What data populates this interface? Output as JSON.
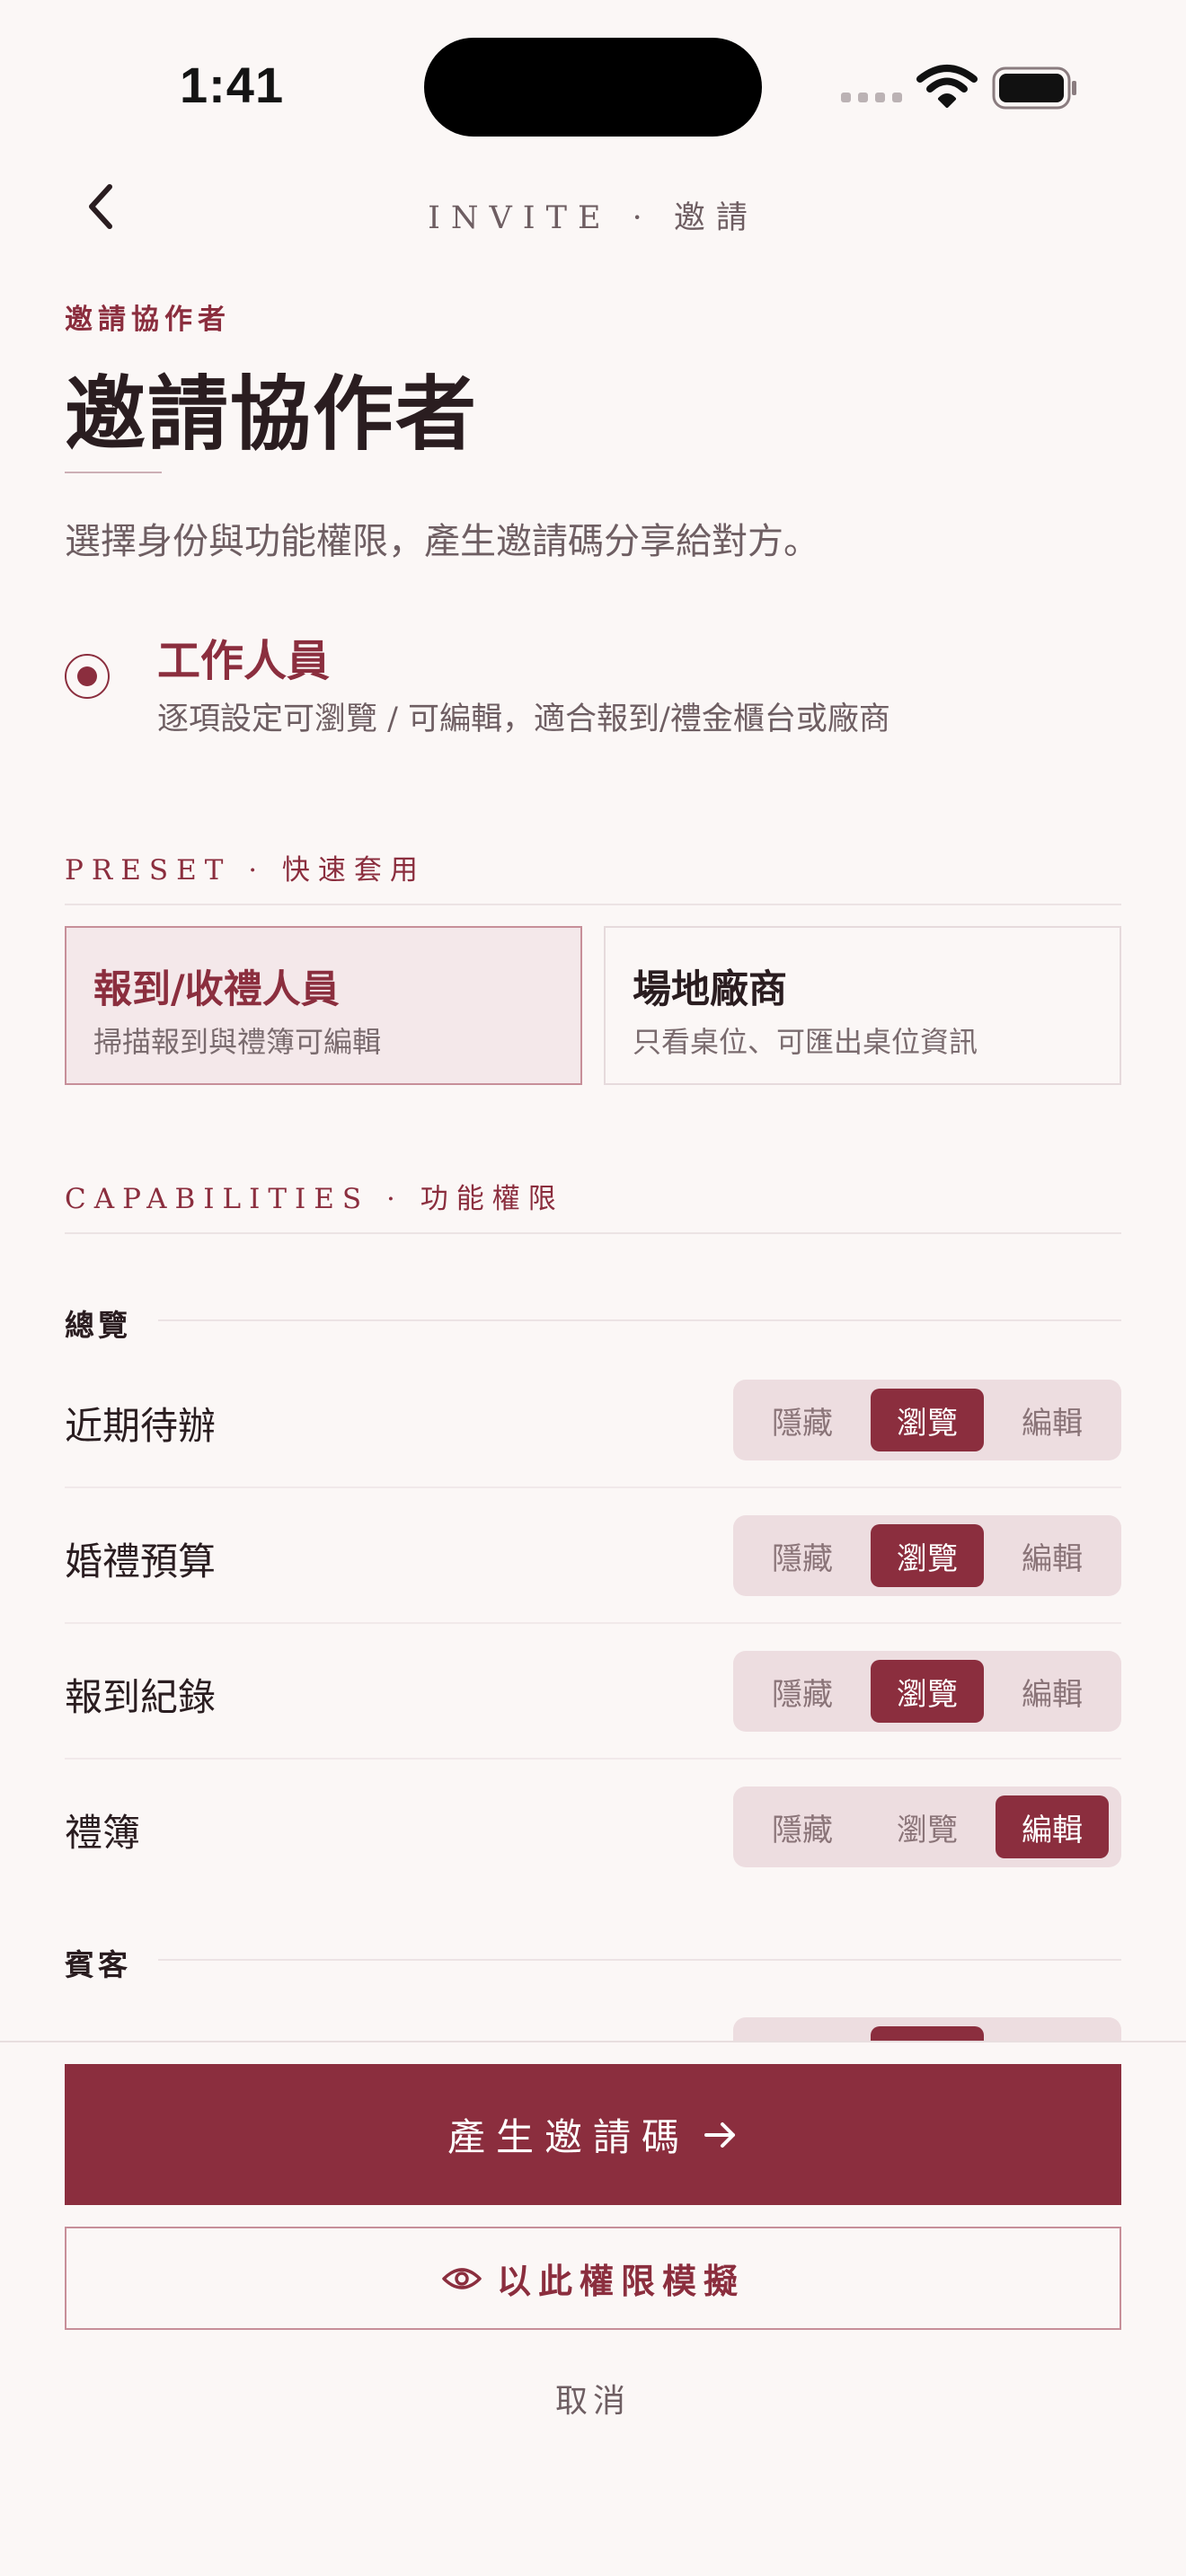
{
  "status_bar": {
    "time": "1:41"
  },
  "nav": {
    "title": "INVITE · 邀請"
  },
  "header": {
    "eyebrow": "邀請協作者",
    "title": "邀請協作者",
    "subtitle": "選擇身份與功能權限，產生邀請碼分享給對方。"
  },
  "role": {
    "selected": true,
    "title": "工作人員",
    "description": "逐項設定可瀏覽 / 可編輯，適合報到/禮金櫃台或廠商"
  },
  "preset": {
    "heading": "PRESET · 快速套用",
    "cards": [
      {
        "title": "報到/收禮人員",
        "description": "掃描報到與禮簿可編輯",
        "active": true
      },
      {
        "title": "場地廠商",
        "description": "只看桌位、可匯出桌位資訊",
        "active": false
      }
    ]
  },
  "capabilities": {
    "heading": "CAPABILITIES · 功能權限",
    "options": [
      "隱藏",
      "瀏覽",
      "編輯"
    ],
    "groups": [
      {
        "label": "總覽",
        "items": [
          {
            "label": "近期待辦",
            "selected": "瀏覽"
          },
          {
            "label": "婚禮預算",
            "selected": "瀏覽"
          },
          {
            "label": "報到紀錄",
            "selected": "瀏覽"
          },
          {
            "label": "禮簿",
            "selected": "編輯"
          }
        ]
      },
      {
        "label": "賓客",
        "items": []
      }
    ]
  },
  "actions": {
    "generate": "產生邀請碼",
    "simulate": "以此權限模擬",
    "cancel": "取消"
  },
  "colors": {
    "accent": "#8B2E3E",
    "background": "#FBF7F6",
    "segment_bg": "#EDDDE0"
  }
}
